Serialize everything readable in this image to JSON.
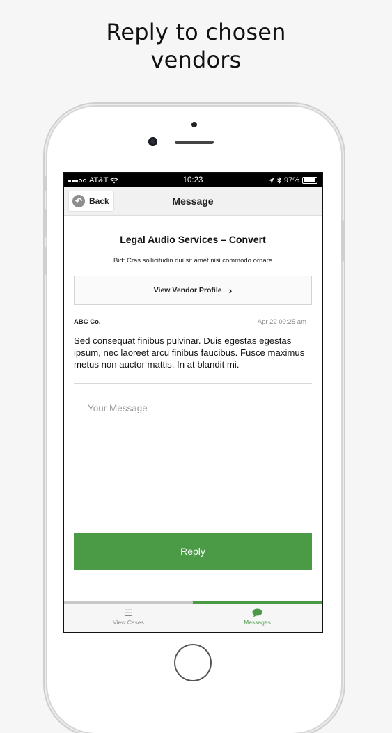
{
  "headline": {
    "line1": "Reply to chosen",
    "line2": "vendors"
  },
  "status_bar": {
    "carrier": "AT&T",
    "time": "10:23",
    "battery": "97%"
  },
  "nav": {
    "back_label": "Back",
    "title": "Message"
  },
  "case": {
    "title": "Legal Audio Services – Convert",
    "bid": "Bid: Cras sollicitudin dui sit amet nisi commodo ornare"
  },
  "vendor_button": {
    "label": "View Vendor Profile"
  },
  "message": {
    "sender": "ABC Co.",
    "timestamp": "Apr 22 09:25 am",
    "body": "Sed consequat finibus pulvinar. Duis egestas egestas ipsum, nec laoreet arcu finibus faucibus. Fusce maximus metus non auctor mattis. In at blandit mi."
  },
  "compose": {
    "placeholder": "Your Message"
  },
  "reply_button": {
    "label": "Reply"
  },
  "tabs": [
    {
      "label": "View Cases",
      "icon": "menu-icon",
      "active": false
    },
    {
      "label": "Messages",
      "icon": "chat-bubble-icon",
      "active": true
    }
  ],
  "colors": {
    "accent": "#4a9a46",
    "background": "#f6f6f6"
  }
}
